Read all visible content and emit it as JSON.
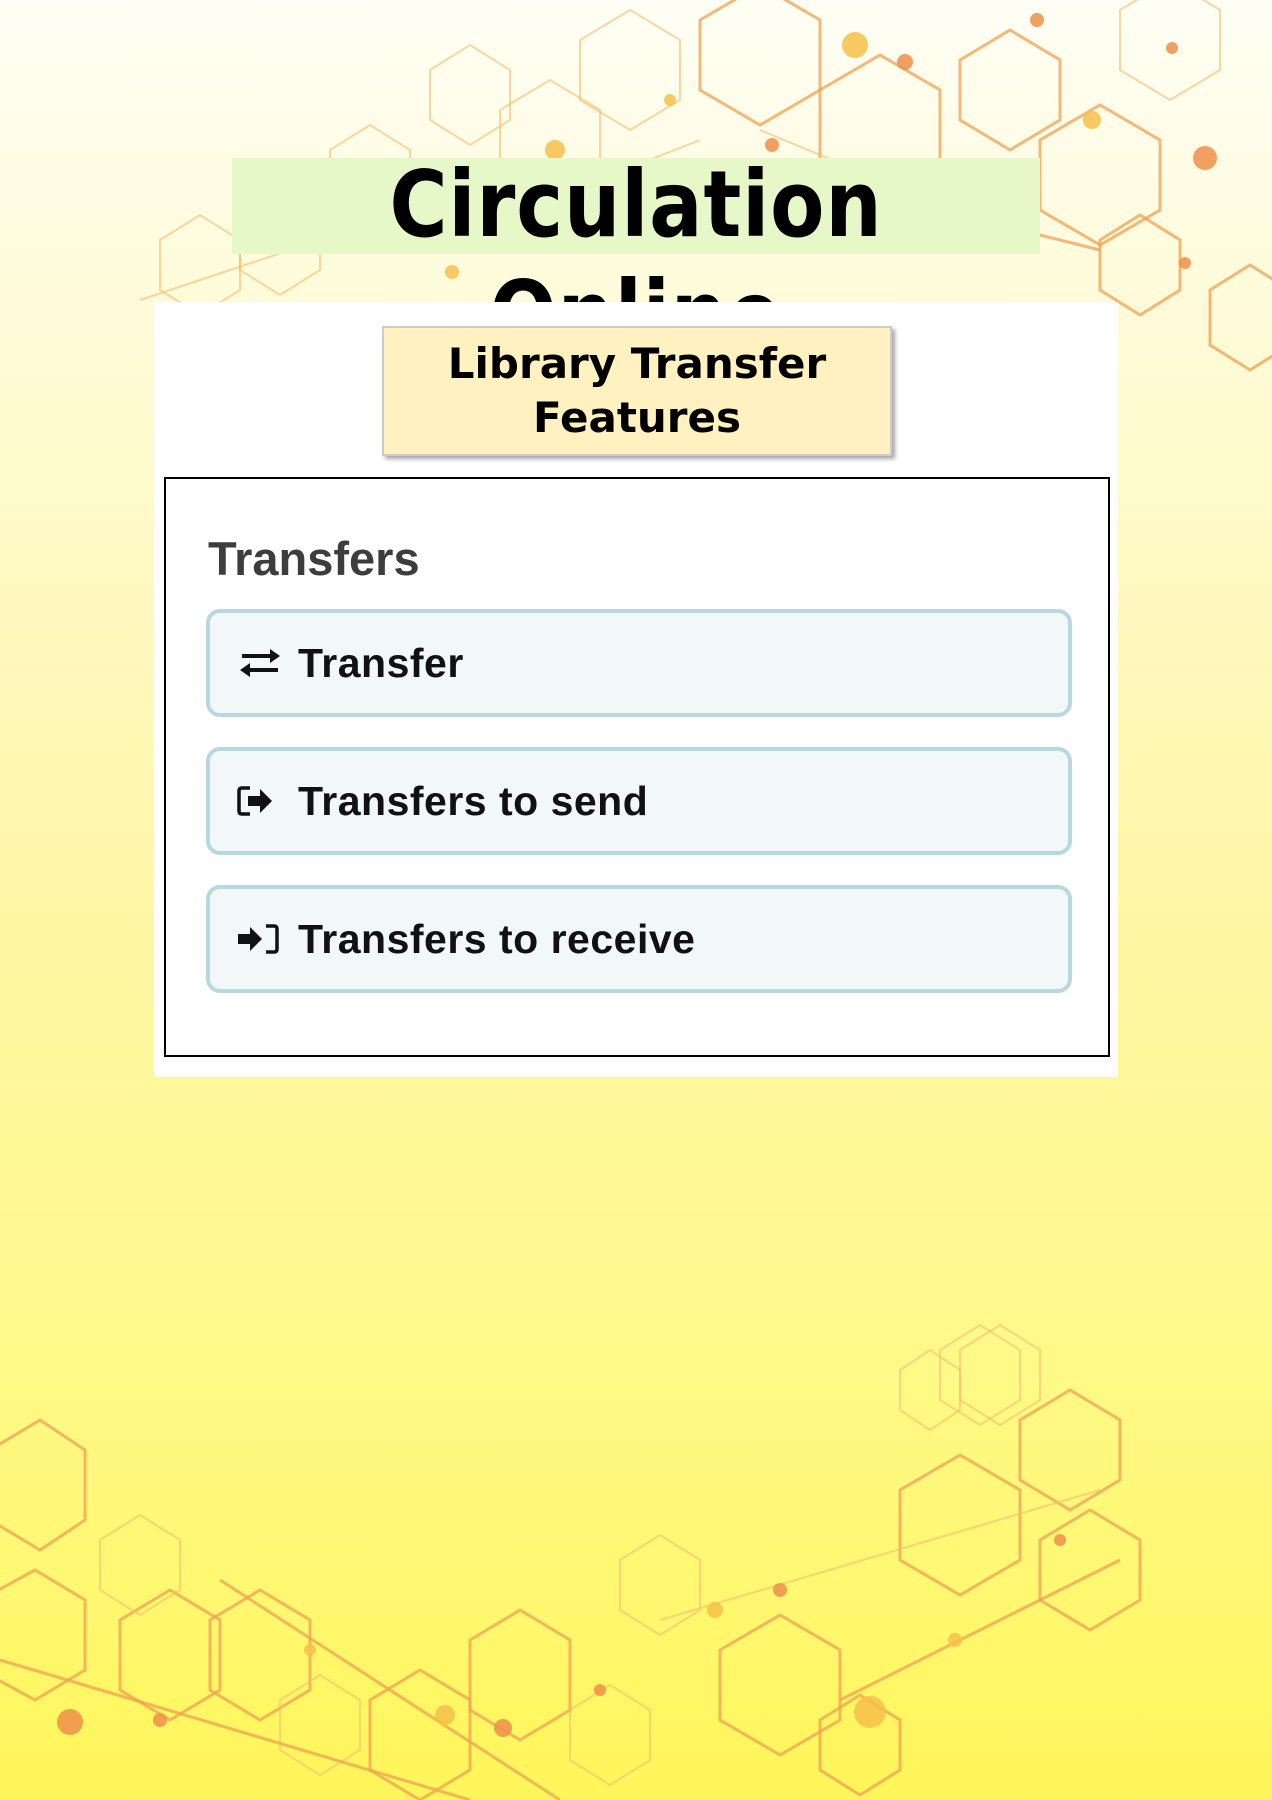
{
  "poster": {
    "title": "Circulation Online",
    "subtitle": "Library Transfer Features"
  },
  "panel": {
    "heading": "Transfers",
    "buttons": [
      {
        "label": "Transfer",
        "icon": "transfer-arrows-icon"
      },
      {
        "label": "Transfers to send",
        "icon": "sign-out-icon"
      },
      {
        "label": "Transfers to receive",
        "icon": "sign-in-icon"
      }
    ]
  },
  "colors": {
    "background_top": "#fffef4",
    "background_bottom": "#fff65a",
    "hexagon_stroke": "#f0a050",
    "title_highlight": "#e6f8c8",
    "subtitle_box": "#fff2c0",
    "button_fill": "#f2f7f8",
    "button_border": "#b8d7de"
  }
}
